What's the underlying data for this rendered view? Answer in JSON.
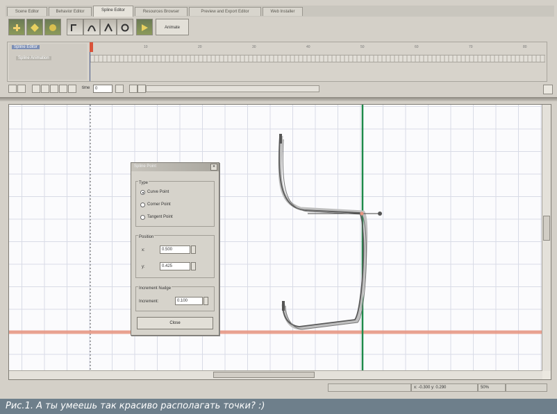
{
  "tabs": [
    {
      "label": "Scene Editor"
    },
    {
      "label": "Behavior Editor"
    },
    {
      "label": "Spline Editor"
    },
    {
      "label": "Resources Browser"
    },
    {
      "label": "Preview and Export Editor"
    },
    {
      "label": "Web Installer"
    }
  ],
  "toolbar": {
    "animate_label": "Animate",
    "icons": [
      "add-point-icon",
      "move-point-icon",
      "delete-point-icon",
      "curve-tool-icon",
      "spline-shape-icon",
      "tangent-icon",
      "loop-icon",
      "play-icon"
    ]
  },
  "timeline": {
    "track_label": "Spline Editor",
    "subtrack_label": "Spline Animation",
    "ruler_ticks": [
      "0",
      "10",
      "20",
      "30",
      "40",
      "50",
      "60",
      "70",
      "80"
    ]
  },
  "controls": {
    "time_label": "time",
    "time_value": "0"
  },
  "status": {
    "cell1": "",
    "cell2": "x: -0.300  y: 0.290",
    "cell3": "50%"
  },
  "dialog": {
    "title": "Spline Point",
    "close_glyph": "×",
    "type_group": "Type",
    "types": [
      {
        "label": "Curve Point",
        "selected": true
      },
      {
        "label": "Corner Point",
        "selected": false
      },
      {
        "label": "Tangent Point",
        "selected": false
      }
    ],
    "position_group": "Position",
    "x_label": "x:",
    "x_value": "0.500",
    "y_label": "y:",
    "y_value": "0.425",
    "nudge_group": "Increment Nudge",
    "nudge_label": "Increment:",
    "nudge_value": "0.100",
    "close_label": "Close"
  },
  "caption": "Рис.1. А ты умеешь так красиво располагать точки? :)",
  "colors": {
    "accent_green": "#1e8a4a",
    "guide_red": "#e8947f",
    "curve": "#5a5a5a"
  }
}
